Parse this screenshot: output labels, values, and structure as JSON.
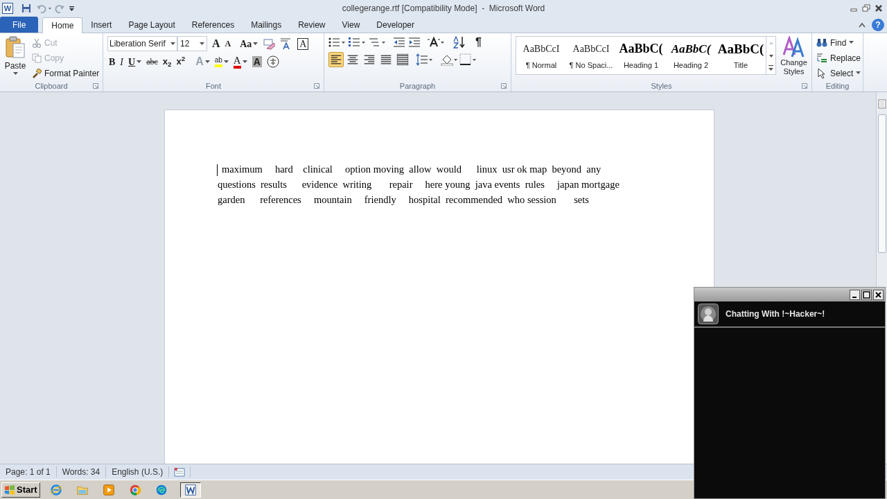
{
  "window": {
    "logo": "W",
    "title": "collegerange.rtf [Compatibility Mode]  -  Microsoft Word",
    "help": "?"
  },
  "tabs": [
    {
      "label": "File",
      "kind": "file",
      "selected": false
    },
    {
      "label": "Home",
      "kind": "tab",
      "selected": true
    },
    {
      "label": "Insert",
      "kind": "tab",
      "selected": false
    },
    {
      "label": "Page Layout",
      "kind": "tab",
      "selected": false
    },
    {
      "label": "References",
      "kind": "tab",
      "selected": false
    },
    {
      "label": "Mailings",
      "kind": "tab",
      "selected": false
    },
    {
      "label": "Review",
      "kind": "tab",
      "selected": false
    },
    {
      "label": "View",
      "kind": "tab",
      "selected": false
    },
    {
      "label": "Developer",
      "kind": "tab",
      "selected": false
    }
  ],
  "clipboard": {
    "label": "Clipboard",
    "paste": "Paste",
    "cut": {
      "label": "Cut",
      "disabled": true
    },
    "copy": {
      "label": "Copy",
      "disabled": true
    },
    "format_painter": {
      "label": "Format Painter",
      "disabled": false
    }
  },
  "font": {
    "label": "Font",
    "font_name": "Liberation Serif",
    "font_size": "12",
    "row1": [
      {
        "kind": "grow",
        "glyph": "A"
      },
      {
        "kind": "shrink",
        "glyph": "A"
      },
      {
        "kind": "case",
        "glyph": "Aa"
      },
      {
        "kind": "clear"
      },
      {
        "kind": "phonetic"
      },
      {
        "kind": "border",
        "glyph": "A"
      }
    ],
    "row2": [
      {
        "kind": "bold",
        "glyph": "B"
      },
      {
        "kind": "italic",
        "glyph": "I"
      },
      {
        "kind": "underline",
        "glyph": "U"
      },
      {
        "kind": "strike",
        "glyph": "abc"
      },
      {
        "kind": "subscript",
        "glyph": "x$_{2}$"
      },
      {
        "kind": "superscript",
        "glyph": "x$^{2}$"
      },
      {
        "kind": "effects",
        "glyph": "A",
        "disabled": true
      },
      {
        "kind": "highlight",
        "glyph": "ab"
      },
      {
        "kind": "color",
        "glyph": "A"
      },
      {
        "kind": "shading",
        "glyph": "A"
      },
      {
        "kind": "enclose"
      }
    ]
  },
  "paragraph": {
    "label": "Paragraph",
    "show_marks": "¶",
    "align_buttons": [
      {
        "kind": "left",
        "selected": true
      },
      {
        "kind": "center",
        "selected": false
      },
      {
        "kind": "right",
        "selected": false
      },
      {
        "kind": "justify",
        "selected": false
      },
      {
        "kind": "distributed",
        "selected": false
      }
    ]
  },
  "styles": {
    "label": "Styles",
    "items": [
      {
        "preview": "AaBbCcI",
        "name": "¶ Normal",
        "kind": "normal"
      },
      {
        "preview": "AaBbCcI",
        "name": "¶ No Spaci...",
        "kind": "normal"
      },
      {
        "preview": "AaBbC(",
        "name": "Heading 1",
        "kind": "heading"
      },
      {
        "preview": "AaBbC(",
        "name": "Heading 2",
        "kind": "heading2"
      },
      {
        "preview": "AaBbC(",
        "name": "Title",
        "kind": "title"
      }
    ],
    "change_styles": [
      "Change",
      "Styles"
    ]
  },
  "editing": {
    "label": "Editing",
    "find": "Find",
    "replace": "Replace",
    "select": "Select"
  },
  "document": {
    "lines": [
      "maximum     hard    clinical     option moving  allow  would      linux  usr ok map  beyond  any",
      "questions  results      evidence  writing       repair     here young  java events  rules     japan mortgage",
      "garden      references     mountain     friendly     hospital  recommended  who session       sets"
    ]
  },
  "status_bar": {
    "page": "Page: 1 of 1",
    "words": "Words: 34",
    "language": "English (U.S.)"
  },
  "taskbar": {
    "start": "Start",
    "apps": [
      {
        "kind": "ie",
        "selected": false
      },
      {
        "kind": "folder",
        "selected": false
      },
      {
        "kind": "media",
        "selected": false
      },
      {
        "kind": "chrome",
        "selected": false
      },
      {
        "kind": "edge",
        "selected": false
      },
      {
        "kind": "word",
        "selected": true
      }
    ]
  },
  "chat": {
    "title": "Chatting With !~Hacker~!"
  }
}
